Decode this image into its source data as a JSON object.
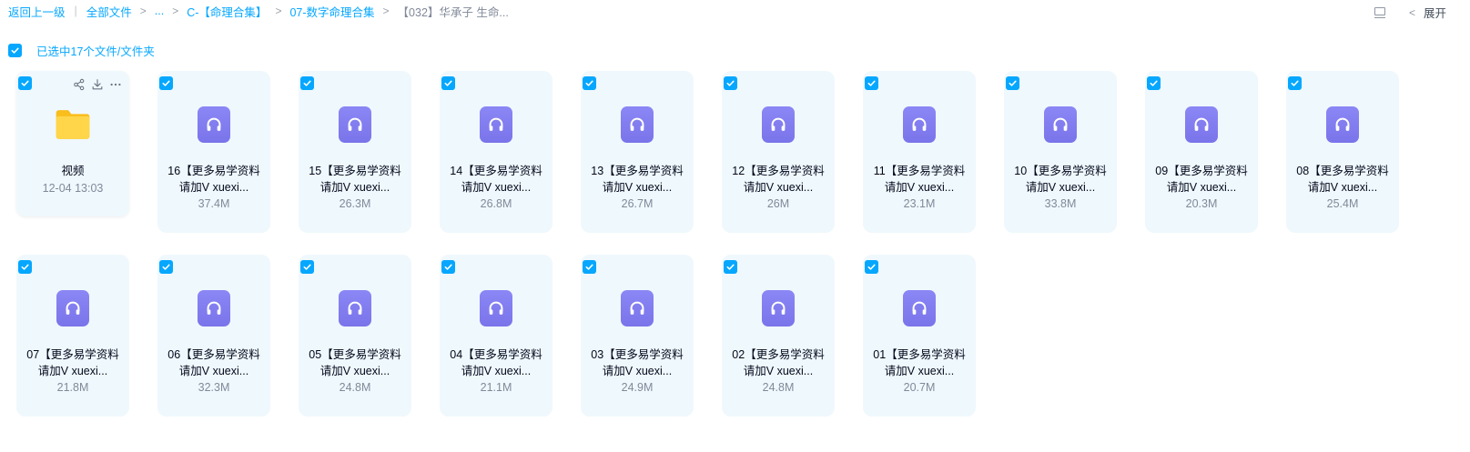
{
  "breadcrumb": {
    "back": "返回上一级",
    "all_files": "全部文件",
    "ellipsis": "...",
    "level1": "C-【命理合集】",
    "level2": "07-数字命理合集",
    "current": "【032】华承子 生命..."
  },
  "toolbar": {
    "expand_label": "展开"
  },
  "selection": {
    "label": "已选中17个文件/文件夹"
  },
  "colors": {
    "accent": "#06a7ff",
    "audio_icon": "#7f7af0",
    "folder": "#ffd64e",
    "card_bg": "#eff8fd"
  },
  "items": [
    {
      "type": "folder",
      "line1": "视频",
      "line2": "",
      "meta": "12-04 13:03"
    },
    {
      "type": "audio",
      "line1": "16【更多易学资料",
      "line2": "请加V xuexi...",
      "meta": "37.4M"
    },
    {
      "type": "audio",
      "line1": "15【更多易学资料",
      "line2": "请加V xuexi...",
      "meta": "26.3M"
    },
    {
      "type": "audio",
      "line1": "14【更多易学资料",
      "line2": "请加V xuexi...",
      "meta": "26.8M"
    },
    {
      "type": "audio",
      "line1": "13【更多易学资料",
      "line2": "请加V xuexi...",
      "meta": "26.7M"
    },
    {
      "type": "audio",
      "line1": "12【更多易学资料",
      "line2": "请加V xuexi...",
      "meta": "26M"
    },
    {
      "type": "audio",
      "line1": "11【更多易学资料",
      "line2": "请加V xuexi...",
      "meta": "23.1M"
    },
    {
      "type": "audio",
      "line1": "10【更多易学资料",
      "line2": "请加V xuexi...",
      "meta": "33.8M"
    },
    {
      "type": "audio",
      "line1": "09【更多易学资料",
      "line2": "请加V xuexi...",
      "meta": "20.3M"
    },
    {
      "type": "audio",
      "line1": "08【更多易学资料",
      "line2": "请加V xuexi...",
      "meta": "25.4M"
    },
    {
      "type": "audio",
      "line1": "07【更多易学资料",
      "line2": "请加V xuexi...",
      "meta": "21.8M"
    },
    {
      "type": "audio",
      "line1": "06【更多易学资料",
      "line2": "请加V xuexi...",
      "meta": "32.3M"
    },
    {
      "type": "audio",
      "line1": "05【更多易学资料",
      "line2": "请加V xuexi...",
      "meta": "24.8M"
    },
    {
      "type": "audio",
      "line1": "04【更多易学资料",
      "line2": "请加V xuexi...",
      "meta": "21.1M"
    },
    {
      "type": "audio",
      "line1": "03【更多易学资料",
      "line2": "请加V xuexi...",
      "meta": "24.9M"
    },
    {
      "type": "audio",
      "line1": "02【更多易学资料",
      "line2": "请加V xuexi...",
      "meta": "24.8M"
    },
    {
      "type": "audio",
      "line1": "01【更多易学资料",
      "line2": "请加V xuexi...",
      "meta": "20.7M"
    }
  ]
}
